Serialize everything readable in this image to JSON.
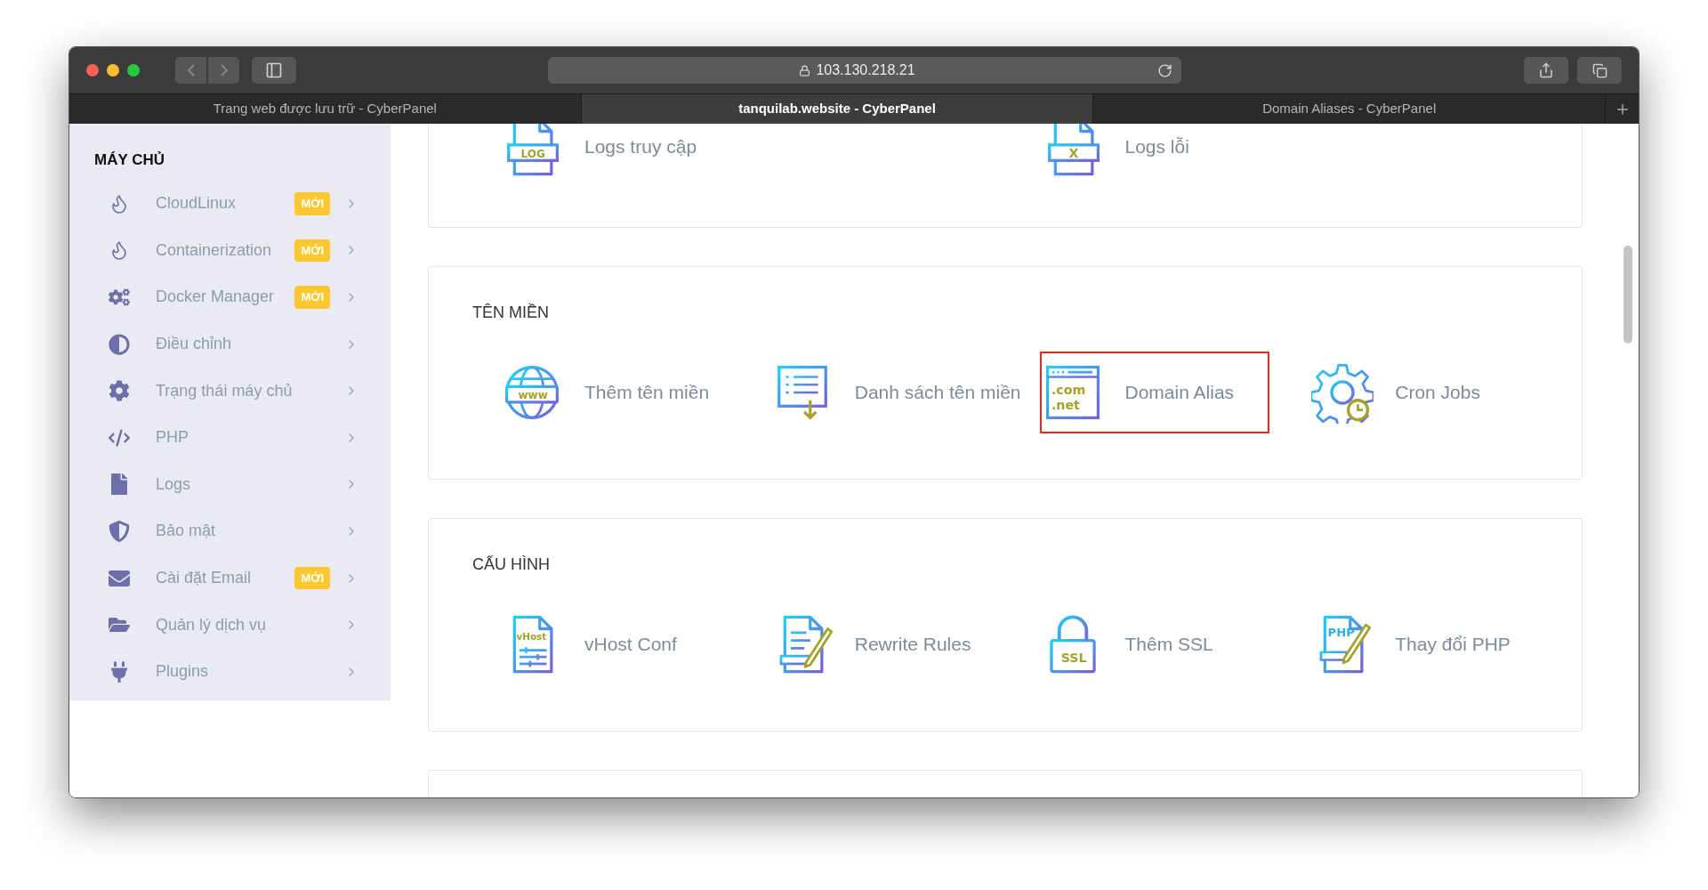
{
  "browser": {
    "address": "103.130.218.21",
    "tabs": [
      {
        "title": "Trang web được lưu trữ - CyberPanel",
        "selected": false
      },
      {
        "title": "tanquilab.website - CyberPanel",
        "selected": true
      },
      {
        "title": "Domain Aliases - CyberPanel",
        "selected": false
      }
    ]
  },
  "sidebar": {
    "section_title": "MÁY CHỦ",
    "items": [
      {
        "kind": "flame",
        "label": "CloudLinux",
        "badge": "MỚI"
      },
      {
        "kind": "flame",
        "label": "Containerization",
        "badge": "MỚI"
      },
      {
        "kind": "cogs",
        "label": "Docker Manager",
        "badge": "MỚI"
      },
      {
        "kind": "contrast",
        "label": "Điều chỉnh"
      },
      {
        "kind": "gear",
        "label": "Trạng thái máy chủ"
      },
      {
        "kind": "code",
        "label": "PHP"
      },
      {
        "kind": "file",
        "label": "Logs"
      },
      {
        "kind": "shield",
        "label": "Bảo mật"
      },
      {
        "kind": "mail",
        "label": "Cài đặt Email",
        "badge": "MỚI"
      },
      {
        "kind": "folder",
        "label": "Quản lý dịch vụ"
      },
      {
        "kind": "plug",
        "label": "Plugins"
      }
    ]
  },
  "sections": [
    {
      "tiles": [
        {
          "kind": "log-file",
          "icon_text": "LOG",
          "label": "Logs truy cập",
          "highlighted": false
        },
        {
          "kind": "error-file",
          "icon_text": "X",
          "label": "Logs lỗi",
          "highlighted": false
        }
      ]
    },
    {
      "title": "TÊN MIỀN",
      "tiles": [
        {
          "kind": "globe",
          "icon_text": "www",
          "label": "Thêm tên miền",
          "highlighted": false
        },
        {
          "kind": "list",
          "label": "Danh sách tên miền",
          "highlighted": false
        },
        {
          "kind": "domain-window",
          "icon_text": ".com .net",
          "label": "Domain Alias",
          "highlighted": true
        },
        {
          "kind": "gear-clock",
          "label": "Cron Jobs",
          "highlighted": false
        }
      ]
    },
    {
      "title": "CẤU HÌNH",
      "tiles": [
        {
          "kind": "vhost-file",
          "icon_text": "vHost",
          "label": "vHost Conf",
          "highlighted": false
        },
        {
          "kind": "edit-file",
          "label": "Rewrite Rules",
          "highlighted": false
        },
        {
          "kind": "padlock",
          "icon_text": "SSL",
          "label": "Thêm SSL",
          "highlighted": false
        },
        {
          "kind": "php-file",
          "icon_text": "PHP",
          "label": "Thay đổi PHP",
          "highlighted": false
        }
      ]
    }
  ]
}
